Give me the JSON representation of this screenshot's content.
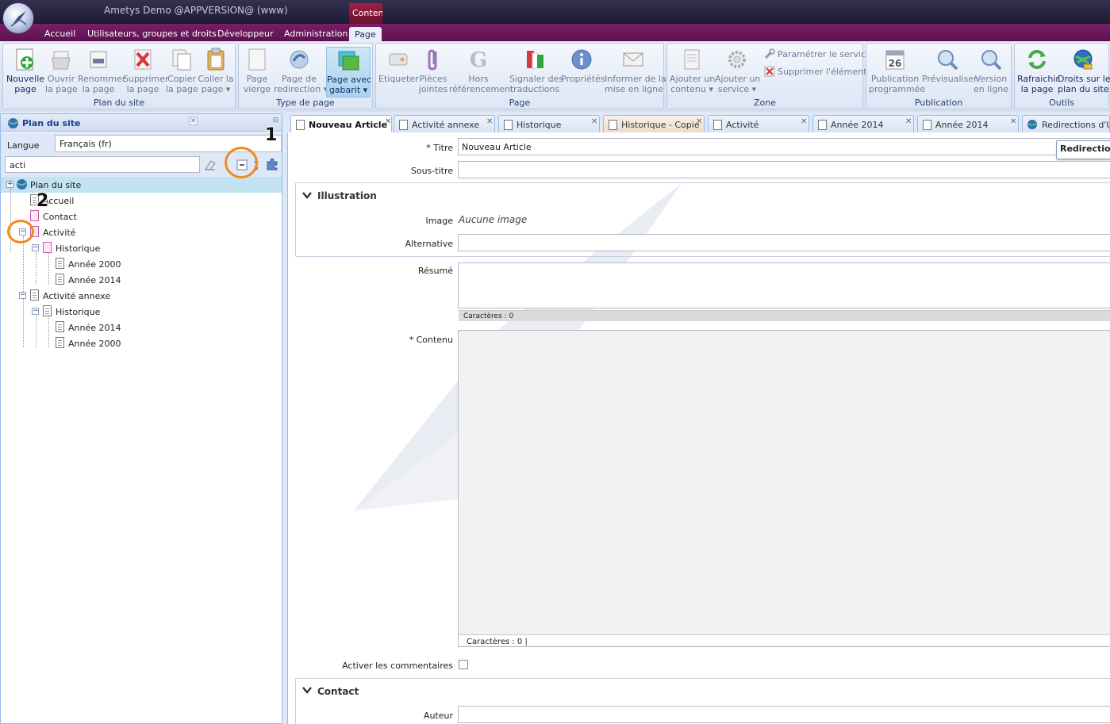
{
  "window": {
    "title": "Ametys Demo @APPVERSION@ (www)",
    "context_group": "Conten"
  },
  "ribbon_tabs": [
    "Accueil",
    "Utilisateurs, groupes et droits",
    "Développeur",
    "Administration",
    "Page"
  ],
  "ribbon": {
    "groups": {
      "plan_du_site": "Plan du site",
      "type_de_page": "Type de page",
      "page": "Page",
      "zone": "Zone",
      "publication": "Publication",
      "outils": "Outils"
    },
    "buttons": {
      "nouvelle_page": [
        "Nouvelle",
        "page"
      ],
      "ouvrir": [
        "Ouvrir",
        "la page"
      ],
      "renommer": [
        "Renommer",
        "la page"
      ],
      "supprimer": [
        "Supprimer",
        "la page"
      ],
      "copier": [
        "Copier",
        "la page"
      ],
      "coller": [
        "Coller la",
        "page ▾"
      ],
      "page_vierge": [
        "Page",
        "vierge"
      ],
      "page_redirection": [
        "Page de",
        "redirection ▾"
      ],
      "page_gabarit": [
        "Page avec",
        "gabarit ▾"
      ],
      "etiqueter": [
        "Etiqueter",
        ""
      ],
      "pieces_jointes": [
        "Pièces",
        "jointes"
      ],
      "hors_referencement": [
        "Hors",
        "référencement"
      ],
      "signaler_traductions": [
        "Signaler des",
        "traductions"
      ],
      "proprietes": [
        "Propriétés",
        ""
      ],
      "informer": [
        "Informer de la",
        "mise en ligne"
      ],
      "ajouter_contenu": [
        "Ajouter un",
        "contenu ▾"
      ],
      "ajouter_service": [
        "Ajouter un",
        "service ▾"
      ],
      "parametrer_service": "Paramétrer le service",
      "supprimer_element": "Supprimer l'élément",
      "publication_programmee": [
        "Publication",
        "programmée"
      ],
      "calendar_day": "26",
      "previsualiser": [
        "Prévisualiser",
        ""
      ],
      "version_en_ligne": [
        "Version",
        "en ligne"
      ],
      "rafraichir": [
        "Rafraichir",
        "la page"
      ],
      "droits_plan": [
        "Droits sur le",
        "plan du site"
      ]
    }
  },
  "left_panel": {
    "title": "Plan du site",
    "langue_label": "Langue",
    "langue_value": "Français (fr)",
    "search_value": "acti",
    "tree": [
      {
        "label": "Plan du site"
      },
      {
        "label": "Accueil"
      },
      {
        "label": "Contact"
      },
      {
        "label": "Activité"
      },
      {
        "label": "Historique"
      },
      {
        "label": "Année 2000"
      },
      {
        "label": "Année 2014"
      },
      {
        "label": "Activité annexe"
      },
      {
        "label": "Historique"
      },
      {
        "label": "Année 2014"
      },
      {
        "label": "Année 2000"
      }
    ]
  },
  "annotations": [
    "1",
    "2"
  ],
  "content_tabs": [
    "Nouveau Article",
    "Activité annexe",
    "Historique",
    "Historique - Copie",
    "Activité",
    "Année 2014",
    "Année 2014",
    "Redirections d'URL"
  ],
  "form": {
    "titre_label": "* Titre",
    "titre_value": "Nouveau Article",
    "redirection_tooltip": "Redirection",
    "soustitre_label": "Sous-titre",
    "illustration_title": "Illustration",
    "image_label": "Image",
    "image_value": "Aucune image",
    "alternative_label": "Alternative",
    "resume_label": "Résumé",
    "chars_resume": "Caractères : 0",
    "contenu_label": "* Contenu",
    "chars_contenu": "Caractères : 0 |",
    "commentaires_label": "Activer les commentaires",
    "contact_title": "Contact",
    "auteur_label": "Auteur"
  }
}
